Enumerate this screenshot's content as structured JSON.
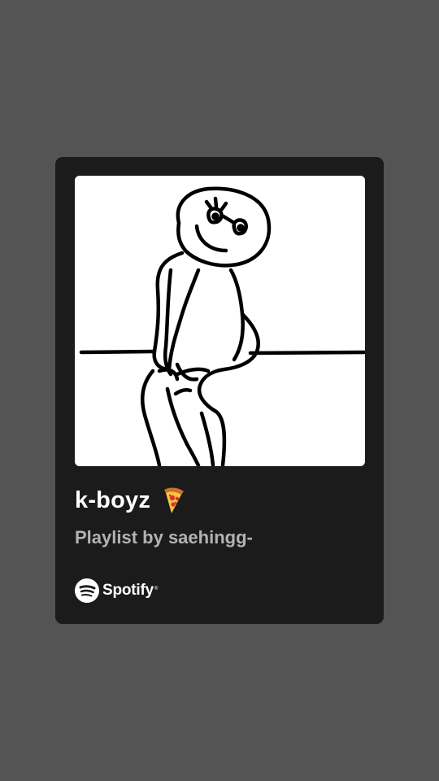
{
  "playlist": {
    "title": "k-boyz",
    "title_emoji_icon": "pizza-icon",
    "subtitle": "Playlist by saehingg-",
    "cover_icon": "doodle-figure-sitting-icon"
  },
  "branding": {
    "name": "Spotify",
    "logo_icon": "spotify-logo-icon",
    "trademark": "®"
  },
  "colors": {
    "background": "#545454",
    "card": "#1b1b1b",
    "title_text": "#ffffff",
    "subtitle_text": "#b3b3b3"
  }
}
